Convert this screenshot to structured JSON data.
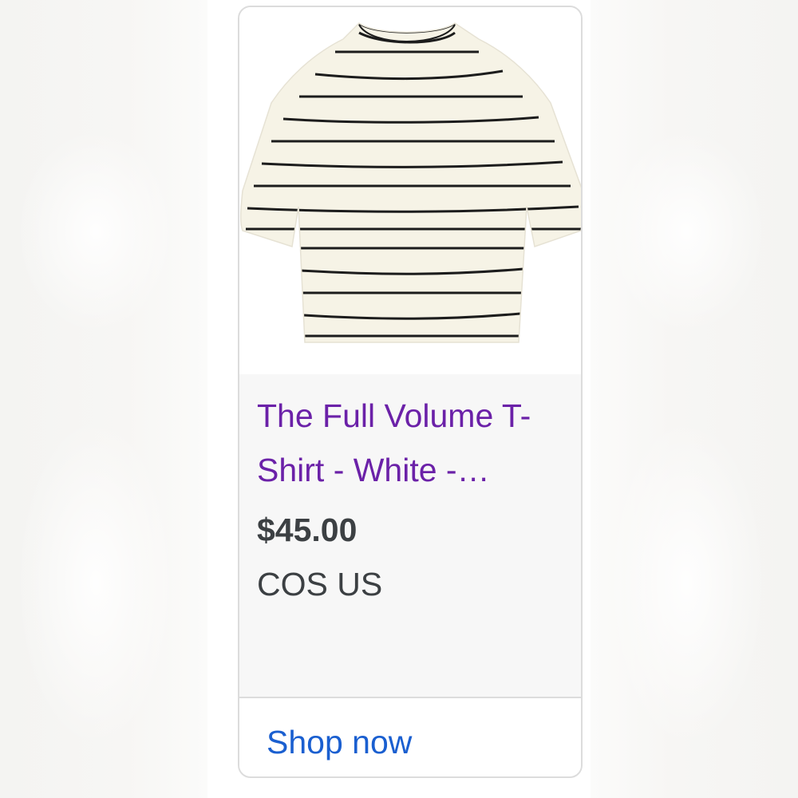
{
  "product": {
    "title": "The Full Volume T-Shirt - White -…",
    "price": "$45.00",
    "store": "COS US",
    "image_icon": "striped-tshirt-image"
  },
  "action": {
    "shop_label": "Shop now"
  },
  "colors": {
    "title": "#6b21a8",
    "link": "#1a5fd0",
    "text": "#3c4043",
    "card_bg": "#f7f7f7",
    "border": "#dcdcdc"
  }
}
